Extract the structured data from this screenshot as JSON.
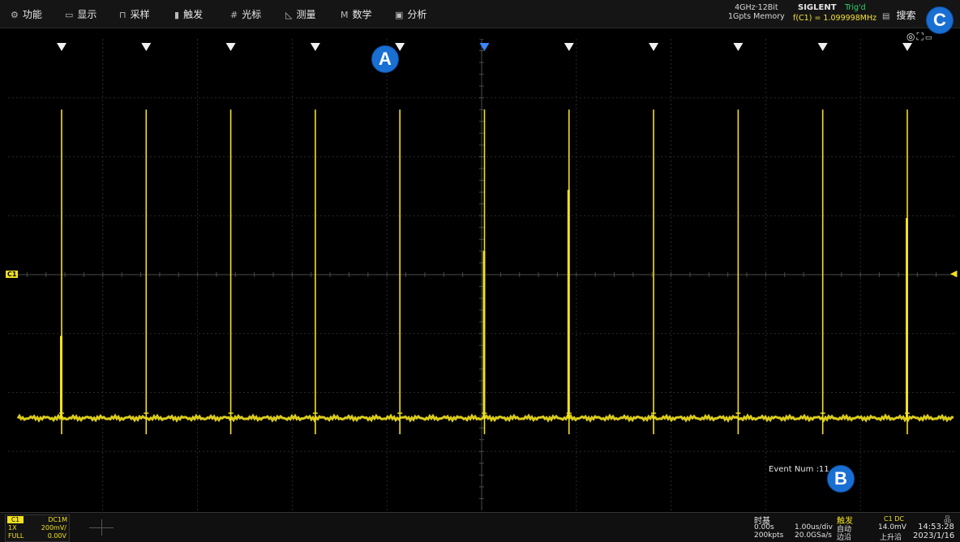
{
  "menu": [
    {
      "icon": "settings-icon",
      "glyph": "⚙",
      "label": "功能"
    },
    {
      "icon": "display-icon",
      "glyph": "▭",
      "label": "显示"
    },
    {
      "icon": "acquire-icon",
      "glyph": "⊓",
      "label": "采样"
    },
    {
      "icon": "trigger-flag-icon",
      "glyph": "▮",
      "label": "触发"
    },
    {
      "icon": "cursor-icon",
      "glyph": "#",
      "label": "光标"
    },
    {
      "icon": "measure-icon",
      "glyph": "◺",
      "label": "测量"
    },
    {
      "icon": "math-icon",
      "glyph": "M",
      "label": "数学"
    },
    {
      "icon": "analysis-icon",
      "glyph": "▣",
      "label": "分析"
    }
  ],
  "status": {
    "spec_line1": "4GHz·12Bit",
    "spec_line2": "1Gpts Memory",
    "brand": "SIGLENT",
    "trig_state": "Trig'd",
    "frequency": "f(C1) = 1.099998MHz",
    "search_label": "搜索"
  },
  "callouts": {
    "a": "A",
    "b": "B",
    "c": "C"
  },
  "event_text": "Event Num :11",
  "channel_marker": "C1",
  "channel": {
    "tag": "C1",
    "coupling": "DC1M",
    "probe": "1X",
    "scale": "200mV/",
    "bandwidth": "FULL",
    "offset": "0.00V"
  },
  "timebase": {
    "title": "时基",
    "delay": "0.00s",
    "scale": "1.00us/div",
    "points": "200kpts",
    "rate": "20.0GSa/s"
  },
  "trigger": {
    "title": "触发",
    "source": "C1 DC",
    "mode": "自动",
    "level": "14.0mV",
    "type": "边沿",
    "slope": "上升沿"
  },
  "clock": {
    "time": "14:53:28",
    "date": "2023/1/16"
  },
  "colors": {
    "trace": "#f2e11e",
    "accent": "#1a6fd2",
    "trig": "#2fd36b",
    "marker_hl": "#3a86ff"
  },
  "event_marks": {
    "count": 11,
    "highlighted": 6
  },
  "pulses": [
    {
      "event": 1,
      "peak": 0.85,
      "mid": 0.37
    },
    {
      "event": 2,
      "peak": 0.85
    },
    {
      "event": 3,
      "peak": 0.85
    },
    {
      "event": 4,
      "peak": 0.85
    },
    {
      "event": 5,
      "peak": 0.85
    },
    {
      "event": 6,
      "peak": 0.85,
      "mid": 0.55
    },
    {
      "event": 7,
      "peak": 0.85,
      "mid": 0.68
    },
    {
      "event": 8,
      "peak": 0.85
    },
    {
      "event": 9,
      "peak": 0.85
    },
    {
      "event": 10,
      "peak": 0.85
    },
    {
      "event": 11,
      "peak": 0.85,
      "mid": 0.62
    }
  ]
}
